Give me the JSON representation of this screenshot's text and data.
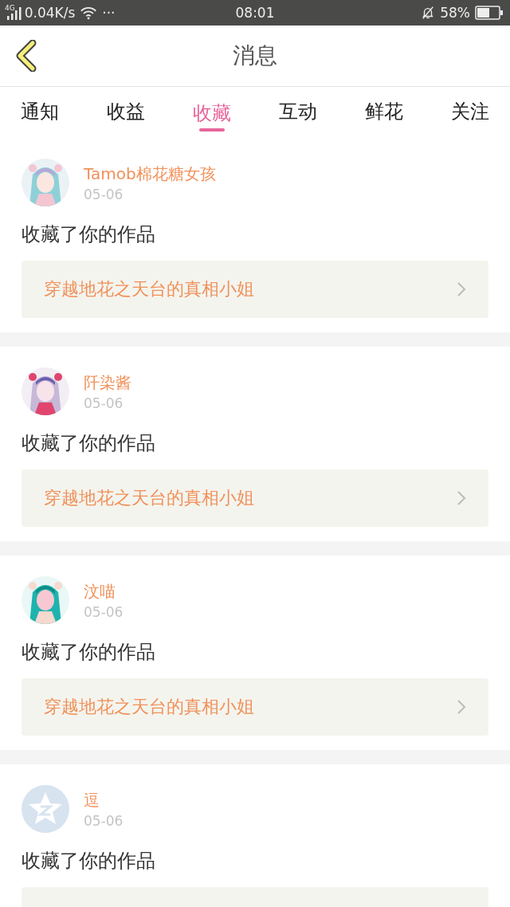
{
  "status_bar": {
    "network": "4G",
    "speed": "0.04K/s",
    "more": "···",
    "time": "08:01",
    "battery": "58%"
  },
  "header": {
    "title": "消息"
  },
  "tabs": [
    {
      "label": "通知",
      "selected": false
    },
    {
      "label": "收益",
      "selected": false
    },
    {
      "label": "收藏",
      "selected": true
    },
    {
      "label": "互动",
      "selected": false
    },
    {
      "label": "鲜花",
      "selected": false
    },
    {
      "label": "关注",
      "selected": false
    }
  ],
  "messages": [
    {
      "name": "Tamob棉花糖女孩",
      "date": "05-06",
      "action": "收藏了你的作品",
      "work": "穿越地花之天台的真相小姐"
    },
    {
      "name": "阡染酱",
      "date": "05-06",
      "action": "收藏了你的作品",
      "work": "穿越地花之天台的真相小姐"
    },
    {
      "name": "汶喵",
      "date": "05-06",
      "action": "收藏了你的作品",
      "work": "穿越地花之天台的真相小姐"
    },
    {
      "avatar": {
        "kind": "default"
      },
      "name": "逗",
      "date": "05-06",
      "action": "收藏了你的作品"
    }
  ]
}
